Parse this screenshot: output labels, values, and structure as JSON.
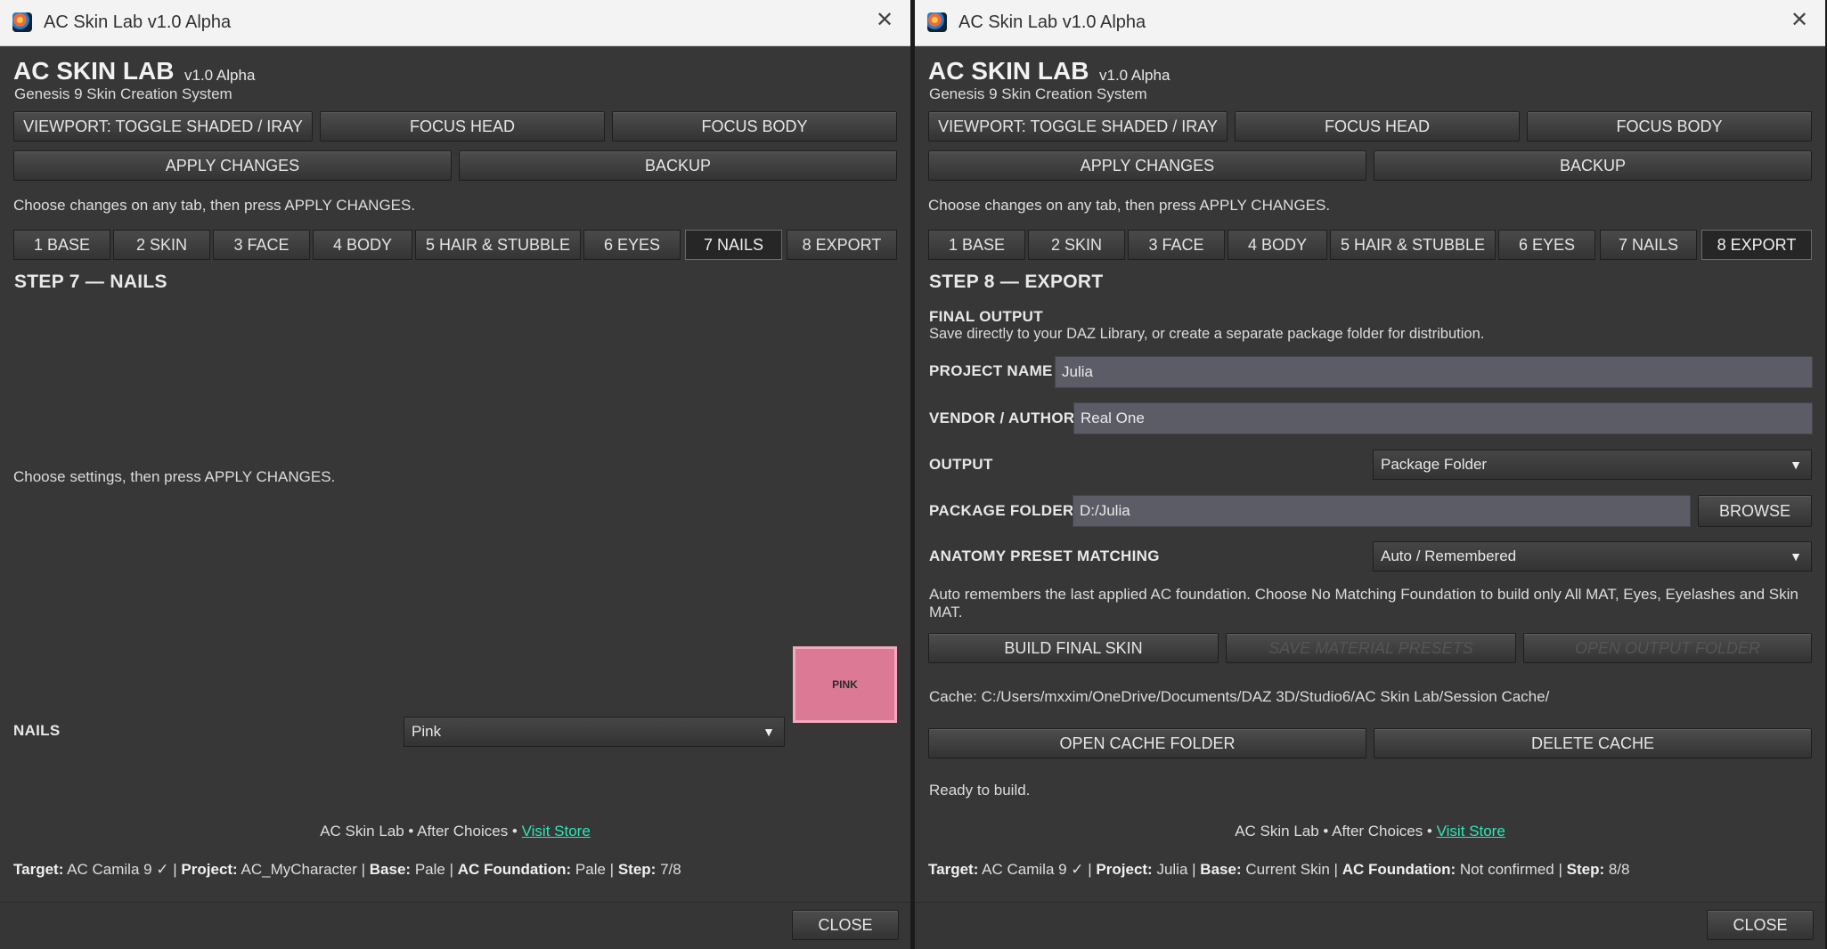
{
  "left": {
    "window_title": "AC Skin Lab v1.0 Alpha",
    "brand": "AC SKIN LAB",
    "version": "v1.0 Alpha",
    "subtitle": "Genesis 9 Skin Creation System",
    "buttons": {
      "viewport": "VIEWPORT: TOGGLE SHADED / IRAY",
      "focus_head": "FOCUS HEAD",
      "focus_body": "FOCUS BODY",
      "apply": "APPLY CHANGES",
      "backup": "BACKUP"
    },
    "hint": "Choose changes on any tab, then press APPLY CHANGES.",
    "tabs": [
      "1 BASE",
      "2 SKIN",
      "3 FACE",
      "4 BODY",
      "5 HAIR & STUBBLE",
      "6 EYES",
      "7 NAILS",
      "8 EXPORT"
    ],
    "active_tab": "7 NAILS",
    "step_title": "STEP 7 — NAILS",
    "settings_hint": "Choose settings, then press APPLY CHANGES.",
    "nails_label": "NAILS",
    "nails_value": "Pink",
    "swatch_label": "PINK",
    "swatch_color": "#dc7a96",
    "credit_prefix": "AC Skin Lab • After Choices •",
    "credit_link": "Visit Store",
    "status": {
      "target_label": "Target:",
      "target": "AC Camila 9 ✓",
      "project_label": "Project:",
      "project": "AC_MyCharacter",
      "base_label": "Base:",
      "base": "Pale",
      "foundation_label": "AC Foundation:",
      "foundation": "Pale",
      "step_label": "Step:",
      "step": "7/8"
    },
    "close": "CLOSE"
  },
  "right": {
    "window_title": "AC Skin Lab v1.0 Alpha",
    "brand": "AC SKIN LAB",
    "version": "v1.0 Alpha",
    "subtitle": "Genesis 9 Skin Creation System",
    "buttons": {
      "viewport": "VIEWPORT: TOGGLE SHADED / IRAY",
      "focus_head": "FOCUS HEAD",
      "focus_body": "FOCUS BODY",
      "apply": "APPLY CHANGES",
      "backup": "BACKUP"
    },
    "hint": "Choose changes on any tab, then press APPLY CHANGES.",
    "tabs": [
      "1 BASE",
      "2 SKIN",
      "3 FACE",
      "4 BODY",
      "5 HAIR & STUBBLE",
      "6 EYES",
      "7 NAILS",
      "8 EXPORT"
    ],
    "active_tab": "8 EXPORT",
    "step_title": "STEP 8 — EXPORT",
    "final_output_title": "FINAL OUTPUT",
    "final_output_desc": "Save directly to your DAZ Library, or create a separate package folder for distribution.",
    "project_name_label": "PROJECT NAME",
    "project_name_value": "Julia",
    "vendor_label": "VENDOR / AUTHOR",
    "vendor_value": "Real One",
    "output_label": "OUTPUT",
    "output_value": "Package Folder",
    "package_folder_label": "PACKAGE FOLDER",
    "package_folder_value": "D:/Julia",
    "browse": "BROWSE",
    "anatomy_label": "ANATOMY PRESET MATCHING",
    "anatomy_value": "Auto / Remembered",
    "anatomy_desc": "Auto remembers the last applied AC foundation. Choose No Matching Foundation to build only All MAT, Eyes, Eyelashes and Skin MAT.",
    "build_final": "BUILD FINAL SKIN",
    "save_presets": "SAVE MATERIAL PRESETS",
    "open_output": "OPEN OUTPUT FOLDER",
    "cache_path": "Cache: C:/Users/mxxim/OneDrive/Documents/DAZ 3D/Studio6/AC Skin Lab/Session Cache/",
    "open_cache": "OPEN CACHE FOLDER",
    "delete_cache": "DELETE CACHE",
    "ready": "Ready to build.",
    "credit_prefix": "AC Skin Lab • After Choices •",
    "credit_link": "Visit Store",
    "status": {
      "target_label": "Target:",
      "target": "AC Camila 9 ✓",
      "project_label": "Project:",
      "project": "Julia",
      "base_label": "Base:",
      "base": "Current Skin",
      "foundation_label": "AC Foundation:",
      "foundation": "Not confirmed",
      "step_label": "Step:",
      "step": "8/8"
    },
    "close": "CLOSE"
  }
}
